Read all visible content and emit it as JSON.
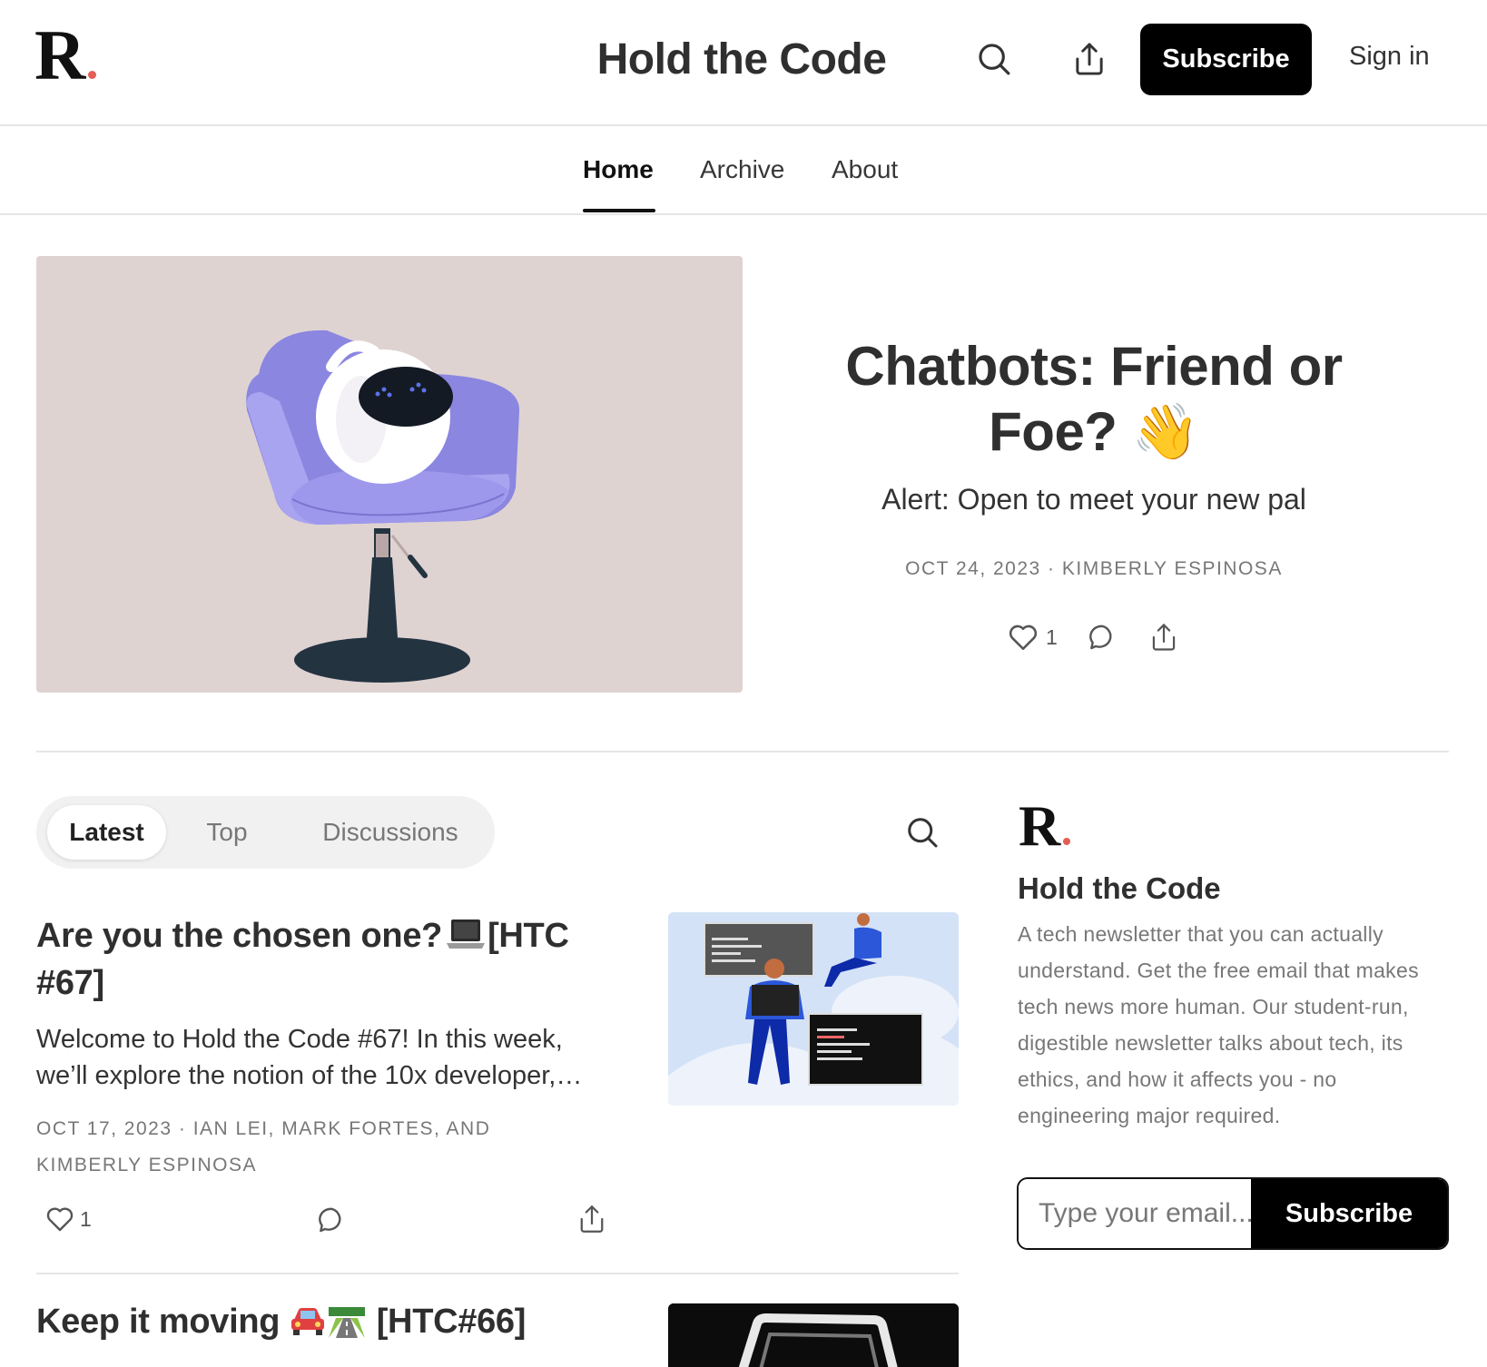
{
  "header": {
    "logo_letter": "R",
    "title": "Hold the Code",
    "subscribe_label": "Subscribe",
    "signin_label": "Sign in",
    "search_icon": "search-icon",
    "share_icon": "share-icon"
  },
  "nav": {
    "items": [
      {
        "label": "Home",
        "active": true
      },
      {
        "label": "Archive",
        "active": false
      },
      {
        "label": "About",
        "active": false
      }
    ]
  },
  "hero": {
    "title": "Chatbots: Friend or Foe? 👋",
    "title_line1": "Chatbots: Friend or",
    "title_line2": "Foe? 👋",
    "subtitle": "Alert: Open to meet your new pal",
    "meta": "OCT 24, 2023 · KIMBERLY ESPINOSA",
    "likes": "1"
  },
  "tabs": {
    "items": [
      {
        "label": "Latest",
        "active": true
      },
      {
        "label": "Top",
        "active": false
      },
      {
        "label": "Discussions",
        "active": false
      }
    ]
  },
  "posts": [
    {
      "title_part1": "Are you the chosen one?",
      "title_emoji": "💻",
      "title_part2": "[HTC #67]",
      "excerpt": "Welcome to Hold the Code #67! In this week, we’ll explore the notion of the 10x developer,…",
      "meta": "OCT 17, 2023 · IAN LEI, MARK FORTES, AND KIMBERLY ESPINOSA",
      "likes": "1"
    },
    {
      "title_part1": "Keep it moving",
      "title_emoji": "🚘🛣️",
      "title_part2": "[HTC#66]"
    }
  ],
  "sidebar": {
    "logo_letter": "R",
    "title": "Hold the Code",
    "description": "A tech newsletter that you can actually understand. Get the free email that makes tech news more human. Our student-run, digestible newsletter talks about tech, its ethics, and how it affects you - no engineering major required.",
    "email_placeholder": "Type your email...",
    "subscribe_label": "Subscribe"
  },
  "colors": {
    "accent_dot": "#e45c55",
    "button_bg": "#000000",
    "hero_bg": "#dfd3d2"
  }
}
